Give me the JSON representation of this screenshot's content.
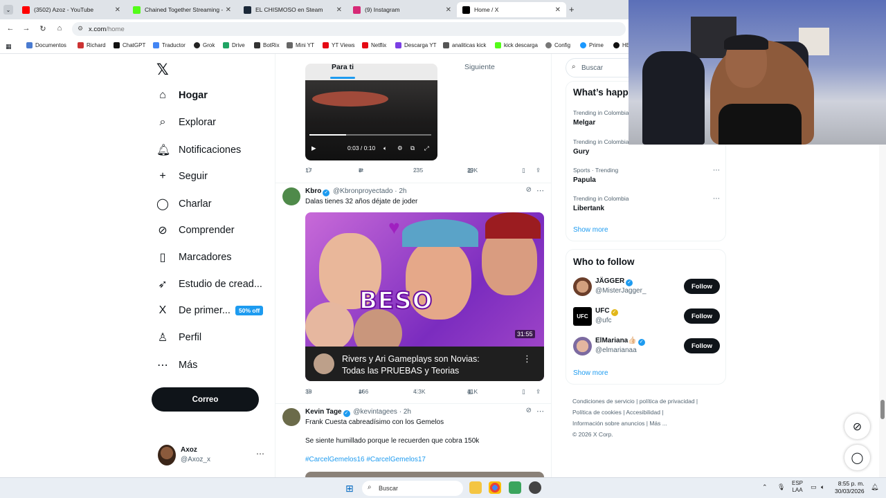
{
  "browser": {
    "tabs": [
      {
        "title": "(3502) Azoz - YouTube",
        "color": "#ff0000"
      },
      {
        "title": "Chained Together Streaming -",
        "color": "#53fc18"
      },
      {
        "title": "EL CHISMOSO en Steam",
        "color": "#1b2838"
      },
      {
        "title": "(9) Instagram",
        "color": "#d62976"
      },
      {
        "title": "Home / X",
        "color": "#000000"
      }
    ],
    "address": {
      "host": "x.com",
      "path": "/home"
    },
    "bookmarks": [
      "Documentos",
      "Richard",
      "ChatGPT",
      "Traductor",
      "Grok",
      "Drive",
      "BotRix",
      "Mini YT",
      "YT Views",
      "Netflix",
      "Descarga YT",
      "analiticas kick",
      "kick descarga",
      "Config",
      "Prime",
      "HE"
    ]
  },
  "sidebar": {
    "items": [
      {
        "label": "Hogar",
        "icon": "home-icon",
        "glyph": "⌂"
      },
      {
        "label": "Explorar",
        "icon": "search-icon",
        "glyph": "⌕"
      },
      {
        "label": "Notificaciones",
        "icon": "bell-icon",
        "glyph": "♫"
      },
      {
        "label": "Seguir",
        "icon": "follow-icon",
        "glyph": "+"
      },
      {
        "label": "Charlar",
        "icon": "chat-icon",
        "glyph": "◯"
      },
      {
        "label": "Comprender",
        "icon": "grok-icon",
        "glyph": "⊘"
      },
      {
        "label": "Marcadores",
        "icon": "bookmark-icon",
        "glyph": "▯"
      },
      {
        "label": "Estudio de cread...",
        "icon": "rocket-icon",
        "glyph": "➶"
      },
      {
        "label": "De primer...",
        "icon": "x-premium-icon",
        "glyph": "X"
      },
      {
        "label": "Perfil",
        "icon": "profile-icon",
        "glyph": "♙"
      },
      {
        "label": "Más",
        "icon": "more-icon",
        "glyph": "⋯"
      }
    ],
    "premium_badge": "50% off",
    "post_button": "Correo",
    "account": {
      "name": "Axoz",
      "handle": "@Axoz_x"
    }
  },
  "timeline": {
    "tabs": [
      "Para ti",
      "Siguiente"
    ],
    "video1": {
      "time": "0:03 / 0:10",
      "progress": 0.3
    },
    "post0_stats": {
      "replies": "17",
      "reposts": "8",
      "likes": "235",
      "views": "29K"
    },
    "posts": [
      {
        "name": "Kbro",
        "handle": "@Kbronproyectado",
        "time": "2h",
        "text": "Dalas tienes 32 años déjate de joder",
        "thumb": {
          "overlay": "BESO",
          "duration": "31:55",
          "yt_title_1": "Rivers y Ari Gameplays son Novias:",
          "yt_title_2": "Todas las PRUEBAS y Teorias"
        },
        "stats": {
          "replies": "38",
          "reposts": "166",
          "likes": "4.3K",
          "views": "41K"
        }
      },
      {
        "name": "Kevin Tage",
        "handle": "@kevintagees",
        "time": "2h",
        "text1": "Frank Cuesta cabreadísimo con los Gemelos",
        "text2": "Se siente humillado porque le recuerden que cobra 150k",
        "hashtags": "#CarcelGemelos16 #CarcelGemelos17"
      }
    ]
  },
  "right": {
    "search_placeholder": "Buscar",
    "trends_title": "What’s happ",
    "trends": [
      {
        "context": "Trending in Colombia",
        "title": "Melgar"
      },
      {
        "context": "Trending in Colombia",
        "title": "Gury"
      },
      {
        "context": "Sports · Trending",
        "title": "Papula"
      },
      {
        "context": "Trending in Colombia",
        "title": "Libertank"
      }
    ],
    "show_more": "Show more",
    "who_title": "Who to follow",
    "follow": [
      {
        "name": "JÄGGER",
        "handle": "@MisterJagger_",
        "badge": "blue"
      },
      {
        "name": "UFC",
        "handle": "@ufc",
        "badge": "gold"
      },
      {
        "name": "ElMariana👍🏻",
        "handle": "@elmarianaa",
        "badge": "blue"
      }
    ],
    "follow_label": "Follow",
    "footer": {
      "line1": "Condiciones de servicio  |   política de privacidad  |",
      "line2": "Política de cookies  |   Accesibilidad  |",
      "line3": "Información sobre anuncios  |   Más ...",
      "line4": "© 2026 X Corp."
    }
  },
  "taskbar": {
    "search": "Buscar",
    "lang1": "ESP",
    "lang2": "LAA",
    "time": "8:55 p. m.",
    "date": "30/03/2026"
  }
}
